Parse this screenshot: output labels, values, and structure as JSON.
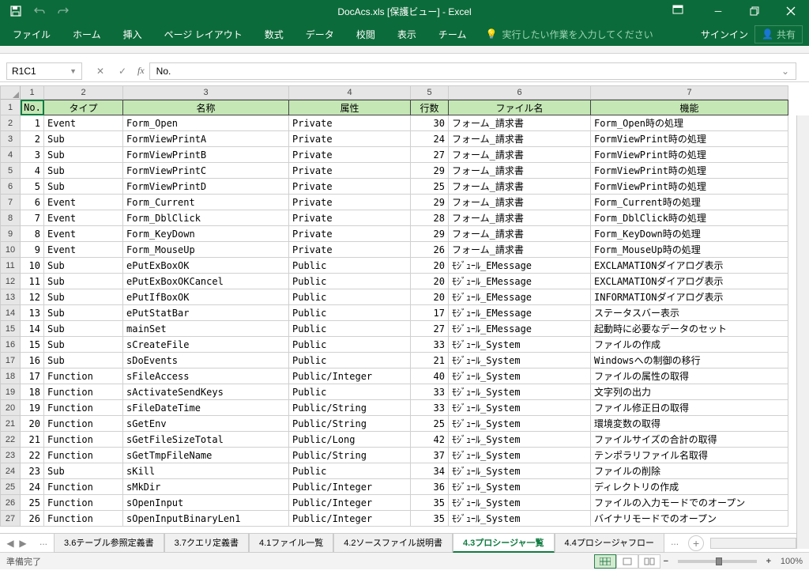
{
  "title": "DocAcs.xls [保護ビュー] - Excel",
  "qat": {
    "save": "save",
    "undo": "undo",
    "redo": "redo"
  },
  "win": {
    "ribbon": "⬚",
    "min": "─",
    "max": "☐",
    "close": "✕"
  },
  "tabs": [
    "ファイル",
    "ホーム",
    "挿入",
    "ページ レイアウト",
    "数式",
    "データ",
    "校閲",
    "表示",
    "チーム"
  ],
  "tellme": "実行したい作業を入力してください",
  "signin": "サインイン",
  "share": "共有",
  "namebox": "R1C1",
  "formula": "No.",
  "col_nums": [
    "1",
    "2",
    "3",
    "4",
    "5",
    "6",
    "7"
  ],
  "headers": [
    "No.",
    "タイプ",
    "名称",
    "属性",
    "行数",
    "ファイル名",
    "機能"
  ],
  "rows": [
    {
      "n": "1",
      "no": "1",
      "type": "Event",
      "name": "Form_Open",
      "attr": "Private",
      "lines": "30",
      "file": "フォーム_請求書",
      "func": "Form_Open時の処理"
    },
    {
      "n": "2",
      "no": "2",
      "type": "Sub",
      "name": "FormViewPrintA",
      "attr": "Private",
      "lines": "24",
      "file": "フォーム_請求書",
      "func": "FormViewPrint時の処理"
    },
    {
      "n": "3",
      "no": "3",
      "type": "Sub",
      "name": "FormViewPrintB",
      "attr": "Private",
      "lines": "27",
      "file": "フォーム_請求書",
      "func": "FormViewPrint時の処理"
    },
    {
      "n": "4",
      "no": "4",
      "type": "Sub",
      "name": "FormViewPrintC",
      "attr": "Private",
      "lines": "29",
      "file": "フォーム_請求書",
      "func": "FormViewPrint時の処理"
    },
    {
      "n": "5",
      "no": "5",
      "type": "Sub",
      "name": "FormViewPrintD",
      "attr": "Private",
      "lines": "25",
      "file": "フォーム_請求書",
      "func": "FormViewPrint時の処理"
    },
    {
      "n": "6",
      "no": "6",
      "type": "Event",
      "name": "Form_Current",
      "attr": "Private",
      "lines": "29",
      "file": "フォーム_請求書",
      "func": "Form_Current時の処理"
    },
    {
      "n": "7",
      "no": "7",
      "type": "Event",
      "name": "Form_DblClick",
      "attr": "Private",
      "lines": "28",
      "file": "フォーム_請求書",
      "func": "Form_DblClick時の処理"
    },
    {
      "n": "8",
      "no": "8",
      "type": "Event",
      "name": "Form_KeyDown",
      "attr": "Private",
      "lines": "29",
      "file": "フォーム_請求書",
      "func": "Form_KeyDown時の処理"
    },
    {
      "n": "9",
      "no": "9",
      "type": "Event",
      "name": "Form_MouseUp",
      "attr": "Private",
      "lines": "26",
      "file": "フォーム_請求書",
      "func": "Form_MouseUp時の処理"
    },
    {
      "n": "10",
      "no": "10",
      "type": "Sub",
      "name": "ePutExBoxOK",
      "attr": "Public",
      "lines": "20",
      "file": "ﾓｼﾞｭｰﾙ_EMessage",
      "func": "EXCLAMATIONダイアログ表示"
    },
    {
      "n": "11",
      "no": "11",
      "type": "Sub",
      "name": "ePutExBoxOKCancel",
      "attr": "Public",
      "lines": "20",
      "file": "ﾓｼﾞｭｰﾙ_EMessage",
      "func": "EXCLAMATIONダイアログ表示"
    },
    {
      "n": "12",
      "no": "12",
      "type": "Sub",
      "name": "ePutIfBoxOK",
      "attr": "Public",
      "lines": "20",
      "file": "ﾓｼﾞｭｰﾙ_EMessage",
      "func": "INFORMATIONダイアログ表示"
    },
    {
      "n": "13",
      "no": "13",
      "type": "Sub",
      "name": "ePutStatBar",
      "attr": "Public",
      "lines": "17",
      "file": "ﾓｼﾞｭｰﾙ_EMessage",
      "func": "ステータスバー表示"
    },
    {
      "n": "14",
      "no": "14",
      "type": "Sub",
      "name": "mainSet",
      "attr": "Public",
      "lines": "27",
      "file": "ﾓｼﾞｭｰﾙ_EMessage",
      "func": "起動時に必要なデータのセット"
    },
    {
      "n": "15",
      "no": "15",
      "type": "Sub",
      "name": "sCreateFile",
      "attr": "Public",
      "lines": "33",
      "file": "ﾓｼﾞｭｰﾙ_System",
      "func": "ファイルの作成"
    },
    {
      "n": "16",
      "no": "16",
      "type": "Sub",
      "name": "sDoEvents",
      "attr": "Public",
      "lines": "21",
      "file": "ﾓｼﾞｭｰﾙ_System",
      "func": "Windowsへの制御の移行"
    },
    {
      "n": "17",
      "no": "17",
      "type": "Function",
      "name": "sFileAccess",
      "attr": "Public/Integer",
      "lines": "40",
      "file": "ﾓｼﾞｭｰﾙ_System",
      "func": "ファイルの属性の取得"
    },
    {
      "n": "18",
      "no": "18",
      "type": "Function",
      "name": "sActivateSendKeys",
      "attr": "Public",
      "lines": "33",
      "file": "ﾓｼﾞｭｰﾙ_System",
      "func": "文字列の出力"
    },
    {
      "n": "19",
      "no": "19",
      "type": "Function",
      "name": "sFileDateTime",
      "attr": "Public/String",
      "lines": "33",
      "file": "ﾓｼﾞｭｰﾙ_System",
      "func": "ファイル修正日の取得"
    },
    {
      "n": "20",
      "no": "20",
      "type": "Function",
      "name": "sGetEnv",
      "attr": "Public/String",
      "lines": "25",
      "file": "ﾓｼﾞｭｰﾙ_System",
      "func": "環境変数の取得"
    },
    {
      "n": "21",
      "no": "21",
      "type": "Function",
      "name": "sGetFileSizeTotal",
      "attr": "Public/Long",
      "lines": "42",
      "file": "ﾓｼﾞｭｰﾙ_System",
      "func": "ファイルサイズの合計の取得"
    },
    {
      "n": "22",
      "no": "22",
      "type": "Function",
      "name": "sGetTmpFileName",
      "attr": "Public/String",
      "lines": "37",
      "file": "ﾓｼﾞｭｰﾙ_System",
      "func": "テンポラリファイル名取得"
    },
    {
      "n": "23",
      "no": "23",
      "type": "Sub",
      "name": "sKill",
      "attr": "Public",
      "lines": "34",
      "file": "ﾓｼﾞｭｰﾙ_System",
      "func": "ファイルの削除"
    },
    {
      "n": "24",
      "no": "24",
      "type": "Function",
      "name": "sMkDir",
      "attr": "Public/Integer",
      "lines": "36",
      "file": "ﾓｼﾞｭｰﾙ_System",
      "func": "ディレクトリの作成"
    },
    {
      "n": "25",
      "no": "25",
      "type": "Function",
      "name": "sOpenInput",
      "attr": "Public/Integer",
      "lines": "35",
      "file": "ﾓｼﾞｭｰﾙ_System",
      "func": "ファイルの入力モードでのオープン"
    },
    {
      "n": "26",
      "no": "26",
      "type": "Function",
      "name": "sOpenInputBinaryLen1",
      "attr": "Public/Integer",
      "lines": "35",
      "file": "ﾓｼﾞｭｰﾙ_System",
      "func": "バイナリモードでのオープン"
    }
  ],
  "sheet_tabs": [
    "...",
    "3.6テーブル参照定義書",
    "3.7クエリ定義書",
    "4.1ファイル一覧",
    "4.2ソースファイル説明書",
    "4.3プロシージャ一覧",
    "4.4プロシージャフロー",
    "..."
  ],
  "active_sheet": 5,
  "status": "準備完了",
  "zoom": "100%"
}
